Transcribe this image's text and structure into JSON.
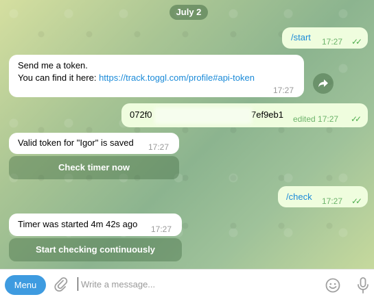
{
  "chat": {
    "date": "July 2",
    "messages": [
      {
        "text": "/start",
        "time": "17:27",
        "direction": "out",
        "status": "✓✓"
      },
      {
        "line1": "Send me a token.",
        "line2_prefix": "You can find it here: ",
        "link": "https://track.toggl.com/profile#api-token",
        "time": "17:27",
        "direction": "in"
      },
      {
        "text_start": "072f0",
        "text_end": "7ef9eb1",
        "edited": "edited 17:27",
        "direction": "out",
        "status": "✓✓"
      },
      {
        "text": "Valid token for \"Igor\" is saved",
        "time": "17:27",
        "direction": "in",
        "button": "Check timer now"
      },
      {
        "text": "/check",
        "time": "17:27",
        "direction": "out",
        "status": "✓✓"
      },
      {
        "text": "Timer was started 4m 42s ago",
        "time": "17:27",
        "direction": "in",
        "button": "Start checking continuously"
      }
    ]
  },
  "input_bar": {
    "menu_label": "Menu",
    "placeholder": "Write a message..."
  },
  "icons": {
    "share": "share-icon",
    "attach": "paperclip-icon",
    "emoji": "emoji-icon",
    "mic": "microphone-icon"
  },
  "colors": {
    "accent": "#3e9be0",
    "outgoing_bubble": "#effdde",
    "check": "#4fae4e",
    "link": "#1a8ad8"
  }
}
